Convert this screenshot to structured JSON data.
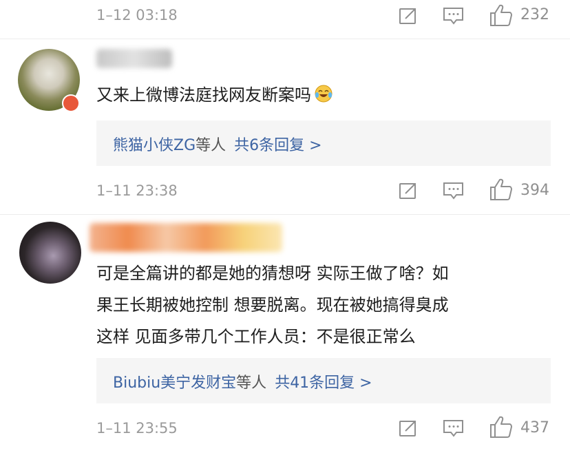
{
  "meta_rows": [
    {
      "time": "1–12 03:18",
      "likes": "232"
    },
    {
      "time": "1–11 23:38",
      "likes": "394"
    },
    {
      "time": "1–11 23:55",
      "likes": "437"
    }
  ],
  "comments": [
    {
      "text": "又来上微博法庭找网友断案吗",
      "reply_summary": {
        "users": "熊猫小侠ZG",
        "suffix": "等人",
        "count_text": "共6条回复 >"
      }
    },
    {
      "lines": [
        "可是全篇讲的都是她的猜想呀 实际王做了啥？如",
        "果王长期被她控制 想要脱离。现在被她搞得臭成",
        "这样 见面多带几个工作人员：不是很正常么"
      ],
      "reply_summary": {
        "users": "Biubiu美宁发财宝",
        "suffix": "等人",
        "count_text": "共41条回复 >"
      }
    }
  ],
  "icons": {
    "share": "share-icon",
    "comment": "comment-icon",
    "like": "thumbs-up-icon",
    "emoji": "laugh-cry-emoji-icon",
    "badge": "verified-badge-icon"
  },
  "colors": {
    "link": "#3d64a3",
    "meta": "#9a9a9a",
    "reply_bg": "#f5f5f5"
  }
}
